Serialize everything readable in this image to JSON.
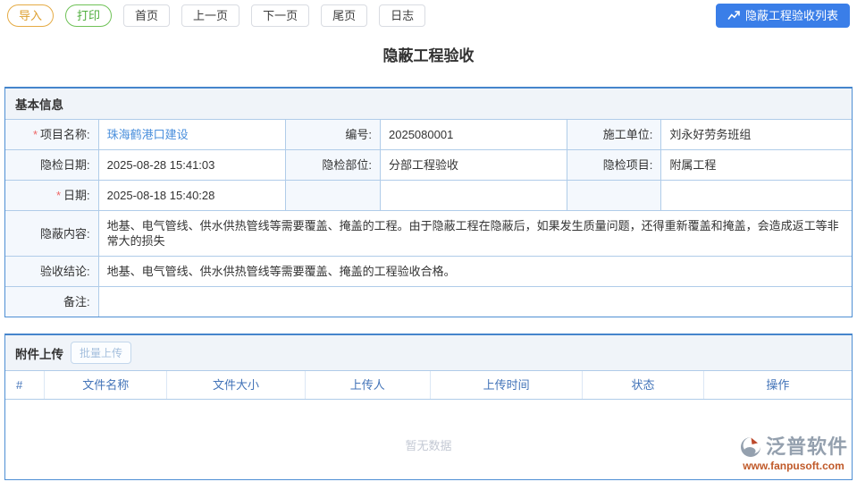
{
  "toolbar": {
    "import_label": "导入",
    "print_label": "打印",
    "first_label": "首页",
    "prev_label": "上一页",
    "next_label": "下一页",
    "last_label": "尾页",
    "log_label": "日志",
    "list_button_label": "隐蔽工程验收列表"
  },
  "page_title": "隐蔽工程验收",
  "basic": {
    "section_title": "基本信息",
    "required_mark": "*",
    "project_label": "项目名称:",
    "project_value": "珠海鹤港口建设",
    "number_label": "编号:",
    "number_value": "2025080001",
    "unit_label": "施工单位:",
    "unit_value": "刘永好劳务班组",
    "check_date_label": "隐检日期:",
    "check_date_value": "2025-08-28 15:41:03",
    "check_part_label": "隐检部位:",
    "check_part_value": "分部工程验收",
    "check_item_label": "隐检项目:",
    "check_item_value": "附属工程",
    "date_label": "日期:",
    "date_value": "2025-08-18 15:40:28",
    "content_label": "隐蔽内容:",
    "content_value": "地基、电气管线、供水供热管线等需要覆盖、掩盖的工程。由于隐蔽工程在隐蔽后，如果发生质量问题，还得重新覆盖和掩盖，会造成返工等非常大的损失",
    "conclusion_label": "验收结论:",
    "conclusion_value": "地基、电气管线、供水供热管线等需要覆盖、掩盖的工程验收合格。",
    "remark_label": "备注:",
    "remark_value": ""
  },
  "attachments": {
    "section_title": "附件上传",
    "batch_upload_label": "批量上传",
    "headers": [
      "#",
      "文件名称",
      "文件大小",
      "上传人",
      "上传时间",
      "状态",
      "操作"
    ],
    "empty_text": "暂无数据",
    "rows": []
  },
  "watermark": {
    "brand": "泛普软件",
    "url": "www.fanpusoft.com"
  },
  "colors": {
    "primary_blue": "#3a7ee8",
    "panel_border_blue": "#4e8fd4",
    "grid_line_blue": "#b0cce9",
    "label_bg": "#f4f8fd",
    "link_blue": "#4a8fdc",
    "table_header_blue": "#4273b8",
    "import_orange": "#dd9f2e",
    "print_green": "#4fae3c",
    "required_red": "#ee6666",
    "watermark_gray": "#94a0ae",
    "watermark_url_orange": "#c05a2a"
  }
}
